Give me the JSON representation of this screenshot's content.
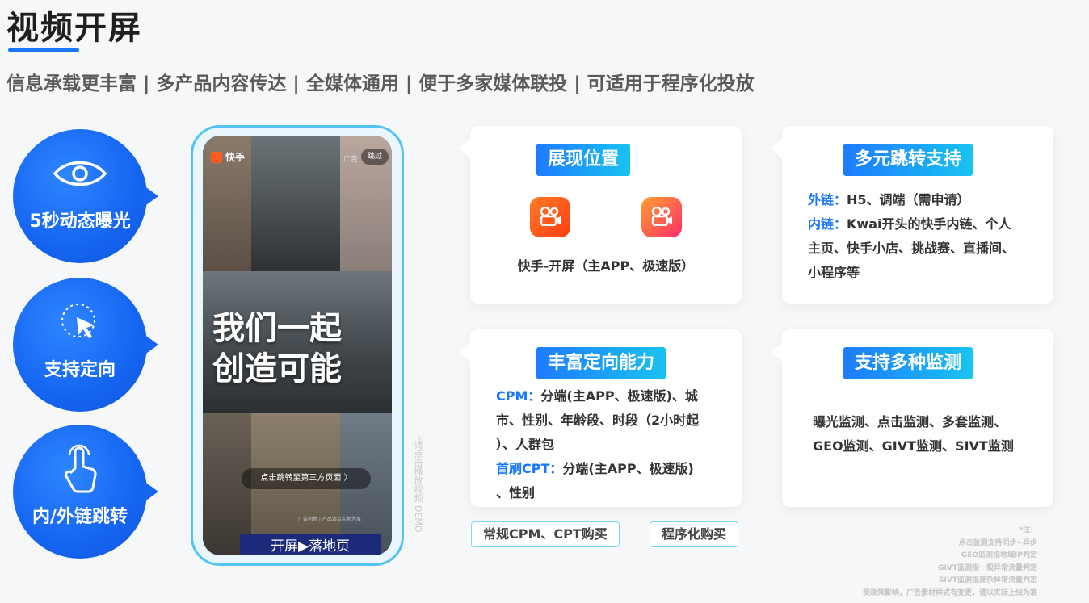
{
  "header": {
    "title": "视频开屏",
    "subtitle": "信息承载更丰富 | 多产品内容传达 | 全媒体通用 | 便于多家媒体联投 | 可适用于程序化投放"
  },
  "features": [
    {
      "label": "5秒动态曝光",
      "icon": "eye-icon"
    },
    {
      "label": "支持定向",
      "icon": "cursor-target-icon"
    },
    {
      "label": "内/外链跳转",
      "icon": "tap-hand-icon"
    }
  ],
  "phone": {
    "app_name": "快手",
    "ad_tag": "广告",
    "skip": "跳过",
    "slogan_line1": "我们一起",
    "slogan_line2": "创造可能",
    "jump_link": "点击跳转至第三方页面 〉",
    "fine_print": "广告创意 | 产品请以实物为准",
    "cta": "开屏▶落地页",
    "side_note": "*请点击播放视频 DEMO"
  },
  "cards": {
    "display": {
      "title": "展现位置",
      "caption": "快手-开屏（主APP、极速版）",
      "icons": [
        "kuaishou-app-icon",
        "kuaishou-speed-app-icon"
      ]
    },
    "redirect": {
      "title": "多元跳转支持",
      "lines": [
        {
          "key": "外链：",
          "text": "H5、调端（需申请）"
        },
        {
          "key": "内链：",
          "text": "Kwai开头的快手内链、个人"
        },
        {
          "key": "",
          "text": "主页、快手小店、挑战赛、直播间、"
        },
        {
          "key": "",
          "text": "小程序等"
        }
      ]
    },
    "targeting": {
      "title": "丰富定向能力",
      "lines": [
        {
          "key": "CPM：",
          "text": "分端(主APP、极速版)、城"
        },
        {
          "key": "",
          "text": "市、性别、年龄段、时段（2小时起"
        },
        {
          "key": "",
          "text": "）、人群包"
        },
        {
          "key": "首刷CPT：",
          "text": "分端(主APP、极速版)"
        },
        {
          "key": "",
          "text": "、性别"
        }
      ]
    },
    "monitoring": {
      "title": "支持多种监测",
      "lines": [
        "曝光监测、点击监测、多套监测、",
        "GEO监测、GIVT监测、SIVT监测"
      ]
    }
  },
  "buy_tags": [
    "常规CPM、CPT购买",
    "程序化购买"
  ],
  "notes": [
    "*注：",
    "点击监测支持同步+异步",
    "GEO监测指地域IP判定",
    "GIVT监测指一般异常流量判定",
    "SIVT监测指复杂异常流量判定",
    "受政策影响，广告素材样式有变更，请以实际上线为准"
  ],
  "colors": {
    "accent": "#1777ff",
    "card_title_gradient": [
      "#1e7bff",
      "#19c3f0"
    ],
    "cta": "#1d2a7a"
  }
}
